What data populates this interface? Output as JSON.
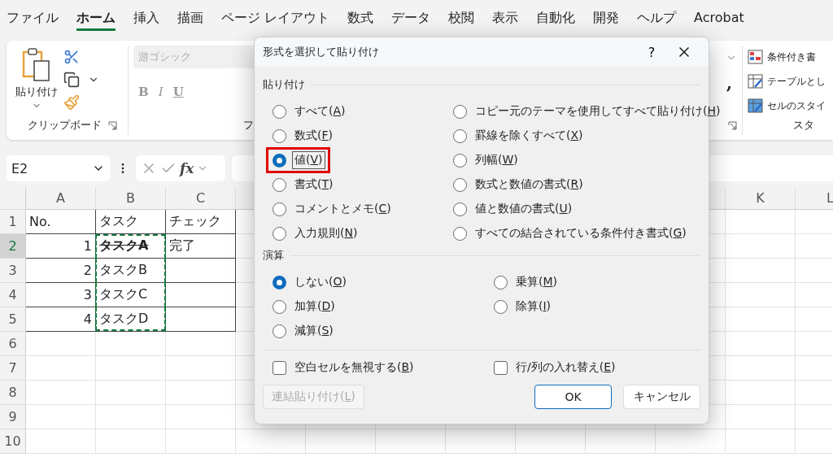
{
  "menu_tabs": [
    {
      "label": "ファイル",
      "selected": false
    },
    {
      "label": "ホーム",
      "selected": true
    },
    {
      "label": "挿入",
      "selected": false
    },
    {
      "label": "描画",
      "selected": false
    },
    {
      "label": "ページ レイアウト",
      "selected": false
    },
    {
      "label": "数式",
      "selected": false
    },
    {
      "label": "データ",
      "selected": false
    },
    {
      "label": "校閲",
      "selected": false
    },
    {
      "label": "表示",
      "selected": false
    },
    {
      "label": "自動化",
      "selected": false
    },
    {
      "label": "開発",
      "selected": false
    },
    {
      "label": "ヘルプ",
      "selected": false
    },
    {
      "label": "Acrobat",
      "selected": false
    }
  ],
  "ribbon": {
    "clipboard": {
      "paste_label": "貼り付け",
      "group_label": "クリップボード"
    },
    "font": {
      "font_name": "游ゴシック",
      "format_buttons": [
        "B",
        "I",
        "U"
      ],
      "group_label": "フ"
    },
    "number": {
      "comma": ","
    },
    "styles": {
      "items": [
        "条件付き書",
        "テーブルとし",
        "セルのスタイ"
      ],
      "group_label": "スタ"
    }
  },
  "formula_bar": {
    "name_box": "E2",
    "fx": "fx"
  },
  "sheet": {
    "columns_left": [
      "A",
      "B",
      "C"
    ],
    "columns_right": [
      "K",
      "L"
    ],
    "rows": [
      {
        "header": "1",
        "selected": false,
        "cells": [
          {
            "text": "No.",
            "kind": "text"
          },
          {
            "text": "タスク",
            "kind": "text"
          },
          {
            "text": "チェック",
            "kind": "text"
          }
        ]
      },
      {
        "header": "2",
        "selected": true,
        "cells": [
          {
            "text": "1",
            "kind": "number"
          },
          {
            "text": "タスクA",
            "kind": "text",
            "strikethrough": true,
            "copied": true
          },
          {
            "text": "完了",
            "kind": "text"
          }
        ]
      },
      {
        "header": "3",
        "selected": false,
        "cells": [
          {
            "text": "2",
            "kind": "number"
          },
          {
            "text": "タスクB",
            "kind": "text",
            "copied": true
          },
          {}
        ]
      },
      {
        "header": "4",
        "selected": false,
        "cells": [
          {
            "text": "3",
            "kind": "number"
          },
          {
            "text": "タスクC",
            "kind": "text",
            "copied": true
          },
          {}
        ]
      },
      {
        "header": "5",
        "selected": false,
        "cells": [
          {
            "text": "4",
            "kind": "number"
          },
          {
            "text": "タスクD",
            "kind": "text",
            "copied": true
          },
          {}
        ]
      },
      {
        "header": "6",
        "selected": false
      },
      {
        "header": "7",
        "selected": false
      },
      {
        "header": "8",
        "selected": false
      },
      {
        "header": "9",
        "selected": false
      },
      {
        "header": "10",
        "selected": false
      }
    ]
  },
  "dialog": {
    "title": "形式を選択して貼り付け",
    "help": "?",
    "paste_section": {
      "label": "貼り付け",
      "options": [
        {
          "label": "すべて(A)",
          "selected": false,
          "kind": "plain"
        },
        {
          "label": "数式(F)",
          "selected": false,
          "kind": "plain"
        },
        {
          "label": "値(V)",
          "selected": true,
          "kind": "boxed"
        },
        {
          "label": "書式(T)",
          "selected": false,
          "kind": "plain"
        },
        {
          "label": "コメントとメモ(C)",
          "selected": false,
          "kind": "plain"
        },
        {
          "label": "入力規則(N)",
          "selected": false,
          "kind": "plain"
        },
        {
          "label": "コピー元のテーマを使用してすべて貼り付け(H)",
          "selected": false,
          "kind": "plain"
        },
        {
          "label": "罫線を除くすべて(X)",
          "selected": false,
          "kind": "plain"
        },
        {
          "label": "列幅(W)",
          "selected": false,
          "kind": "plain"
        },
        {
          "label": "数式と数値の書式(R)",
          "selected": false,
          "kind": "plain"
        },
        {
          "label": "値と数値の書式(U)",
          "selected": false,
          "kind": "plain"
        },
        {
          "label": "すべての結合されている条件付き書式(G)",
          "selected": false,
          "kind": "plain"
        }
      ]
    },
    "operation_section": {
      "label": "演算",
      "options": [
        {
          "label": "しない(O)",
          "selected": true
        },
        {
          "label": "加算(D)",
          "selected": false
        },
        {
          "label": "減算(S)",
          "selected": false
        },
        {
          "label": "乗算(M)",
          "selected": false
        },
        {
          "label": "除算(I)",
          "selected": false
        }
      ]
    },
    "checkboxes": [
      {
        "label": "空白セルを無視する(B)",
        "checked": false
      },
      {
        "label": "行/列の入れ替え(E)",
        "checked": false
      }
    ],
    "left_buttons": [
      {
        "label": "連結貼り付け(L)",
        "disabled": true,
        "default": false
      }
    ],
    "right_buttons": [
      {
        "label": "OK",
        "disabled": false,
        "default": true
      },
      {
        "label": "キャンセル",
        "disabled": false,
        "default": false
      }
    ]
  }
}
